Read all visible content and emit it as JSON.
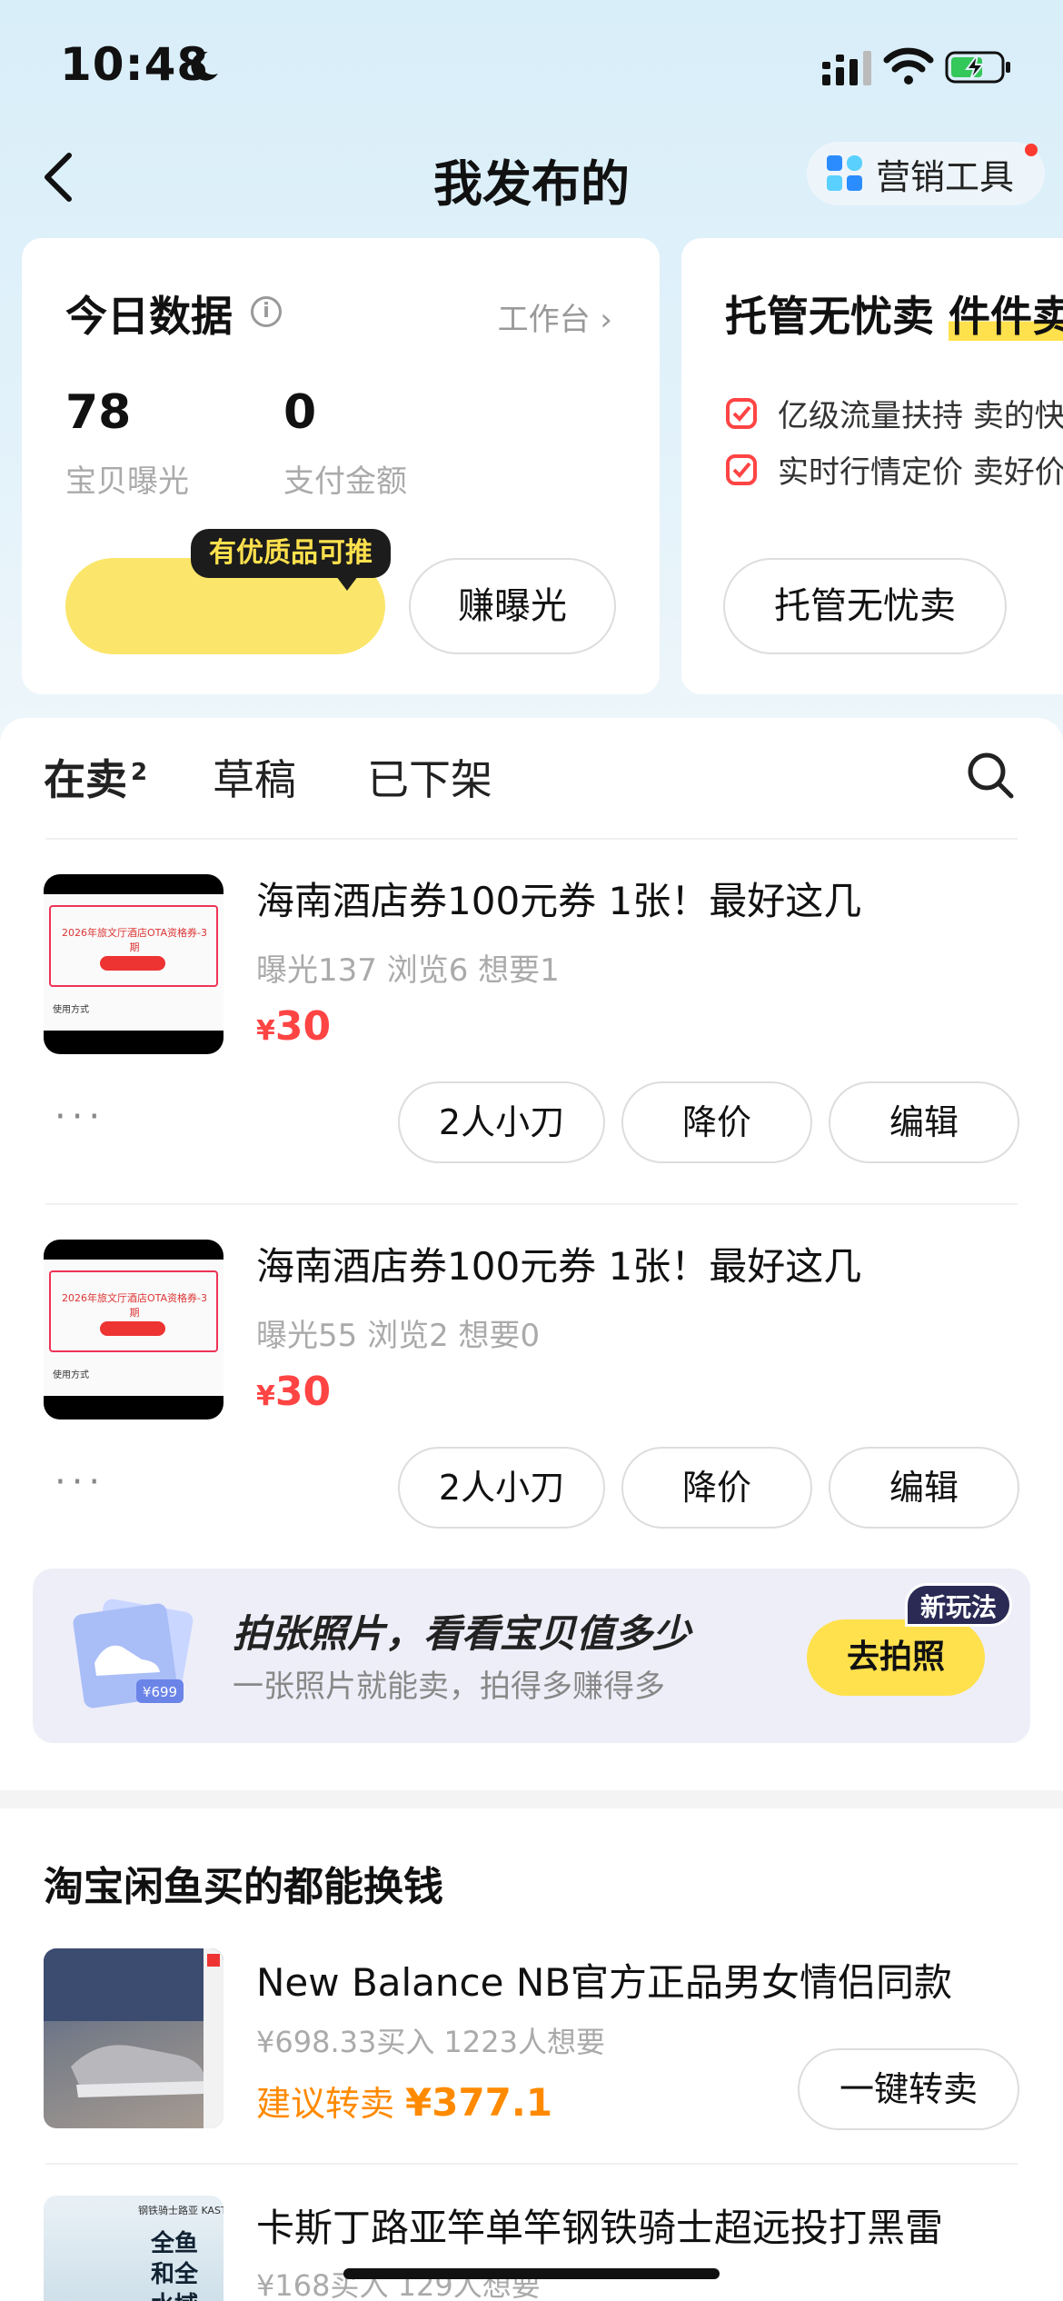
{
  "status_bar": {
    "time": "10:48"
  },
  "header": {
    "title": "我发布的",
    "marketing_tool": "营销工具"
  },
  "today_card": {
    "title": "今日数据",
    "workbench": "工作台",
    "exposure_value": "78",
    "exposure_label": "宝贝曝光",
    "pay_value": "0",
    "pay_label": "支付金额",
    "tip": "有优质品可推",
    "earn_btn": "赚曝光"
  },
  "managed_card": {
    "title_prefix": "托管无忧卖 ",
    "title_highlight": "件件卖",
    "bullet1": "亿级流量扶持  卖的快",
    "bullet2": "实时行情定价  卖好价",
    "button": "托管无忧卖"
  },
  "tabs": {
    "selling": "在卖",
    "selling_count": "2",
    "draft": "草稿",
    "offline": "已下架"
  },
  "listings": [
    {
      "title": "海南酒店券100元券 1张！最好这几",
      "stats": "曝光137   浏览6   想要1",
      "price": "30",
      "currency": "¥",
      "doc_title": "2026年旅文厅酒店OTA资格券-3期",
      "doc_footer": "使用方式",
      "more": "···",
      "btn_bargain": "2人小刀",
      "btn_cut": "降价",
      "btn_edit": "编辑"
    },
    {
      "title": "海南酒店券100元券 1张！最好这几",
      "stats": "曝光55   浏览2   想要0",
      "price": "30",
      "currency": "¥",
      "doc_title": "2026年旅文厅酒店OTA资格券-3期",
      "doc_footer": "使用方式",
      "more": "···",
      "btn_bargain": "2人小刀",
      "btn_cut": "降价",
      "btn_edit": "编辑"
    }
  ],
  "photo_banner": {
    "title": "拍张照片，看看宝贝值多少",
    "subtitle": "一张照片就能卖，拍得多赚得多",
    "img_price": "¥699",
    "new_tag": "新玩法",
    "button": "去拍照"
  },
  "resell": {
    "heading": "淘宝闲鱼买的都能换钱",
    "items": [
      {
        "title": "New Balance NB官方正品男女情侣同款",
        "stats": "¥698.33买入   1223人想要",
        "suggest_label": "建议转卖",
        "suggest_price": "¥377.1",
        "button": "一键转卖"
      },
      {
        "title": "卡斯丁路亚竿单竿钢铁骑士超远投打黑雷",
        "stats": "¥168买入   129人想要",
        "img_text": "全鱼和全水域",
        "brand": "钢铁骑士路亚 KASTKING"
      }
    ]
  },
  "colors": {
    "accent_yellow": "#ffe14d",
    "price_red": "#ff4444",
    "suggest_orange": "#ff8a00"
  }
}
